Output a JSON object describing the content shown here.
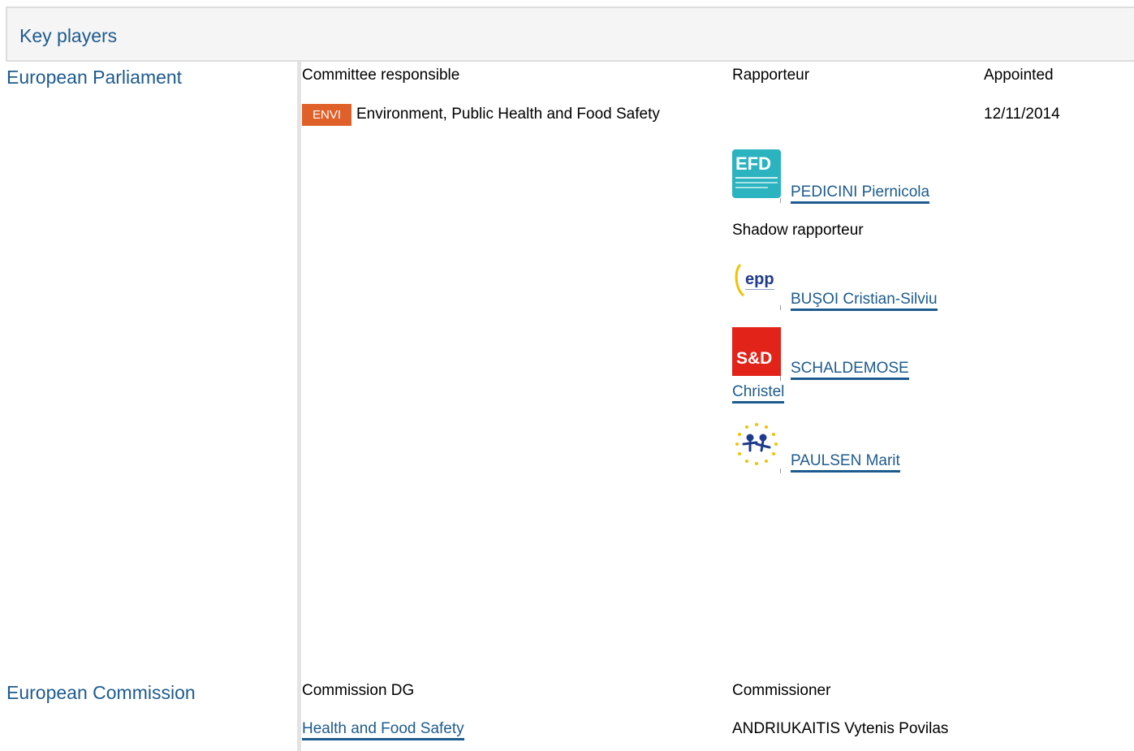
{
  "header": {
    "title": "Key players"
  },
  "parliament": {
    "label": "European Parliament",
    "col_committee": "Committee responsible",
    "col_rapporteur": "Rapporteur",
    "col_appointed": "Appointed",
    "committee": {
      "code": "ENVI",
      "name": "Environment, Public Health and Food Safety",
      "appointed": "12/11/2014"
    },
    "rapporteur": {
      "name": "PEDICINI Piernicola",
      "group_logo": "efdd-logo"
    },
    "shadow_label": "Shadow rapporteur",
    "shadows": [
      {
        "name": "BUŞOI Cristian-Silviu",
        "group_logo": "epp-logo"
      },
      {
        "name_line1": "SCHALDEMOSE",
        "name_line2": "Christel",
        "group_logo": "sd-logo"
      },
      {
        "name": "PAULSEN Marit",
        "group_logo": "alde-logo"
      }
    ]
  },
  "commission": {
    "label": "European Commission",
    "col_dg": "Commission DG",
    "col_commissioner": "Commissioner",
    "dg": "Health and Food Safety",
    "commissioner": "ANDRIUKAITIS Vytenis Povilas"
  },
  "colors": {
    "link": "#1d5b8e",
    "badge": "#e0602a",
    "efdd": "#2bb3c0",
    "sd": "#e2231a",
    "epp": "#1e3c8c"
  }
}
